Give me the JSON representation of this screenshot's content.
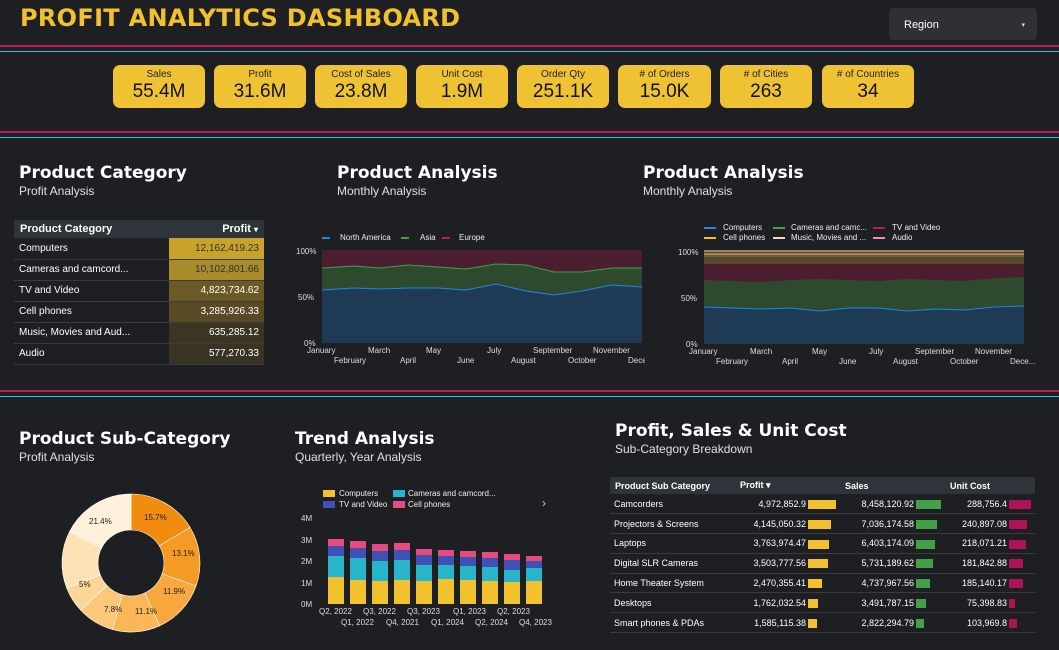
{
  "header": {
    "title": "PROFIT ANALYTICS DASHBOARD",
    "region_label": "Region",
    "region_caret": "▾"
  },
  "kpis": [
    {
      "label": "Sales",
      "value": "55.4M"
    },
    {
      "label": "Profit",
      "value": "31.6M"
    },
    {
      "label": "Cost of Sales",
      "value": "23.8M"
    },
    {
      "label": "Unit Cost",
      "value": "1.9M"
    },
    {
      "label": "Order Qty",
      "value": "251.1K"
    },
    {
      "label": "# of Orders",
      "value": "15.0K"
    },
    {
      "label": "# of Cities",
      "value": "263"
    },
    {
      "label": "# of Countries",
      "value": "34"
    }
  ],
  "colors": {
    "accent": "#f2c12e",
    "kpi_bg": "#eec232",
    "line_pink": "#c2185b",
    "line_teal": "#26c6da",
    "bg": "#1e1f23"
  },
  "product_category": {
    "title": "Product Category",
    "subtitle": "Profit Analysis",
    "col1": "Product Category",
    "col2": "Profit",
    "sort_icon": "▾",
    "rows": [
      {
        "name": "Computers",
        "profit": "12,162,419.23",
        "shade": "#c8a32a"
      },
      {
        "name": "Cameras and camcord...",
        "profit": "10,102,801.66",
        "shade": "#a88b2a"
      },
      {
        "name": "TV and Video",
        "profit": "4,823,734.62",
        "shade": "#6b5a26"
      },
      {
        "name": "Cell phones",
        "profit": "3,285,926.33",
        "shade": "#574a24"
      },
      {
        "name": "Music, Movies and Aud...",
        "profit": "635,285.12",
        "shade": "#3b3522"
      },
      {
        "name": "Audio",
        "profit": "577,270.33",
        "shade": "#383322"
      }
    ]
  },
  "product_analysis_1": {
    "title": "Product Analysis",
    "subtitle": "Monthly Analysis",
    "legend": [
      "North America",
      "Asia",
      "Europe"
    ],
    "y_ticks": [
      "100%",
      "50%",
      "0%"
    ],
    "months_top": [
      "January",
      "March",
      "May",
      "July",
      "September",
      "November"
    ],
    "months_bottom": [
      "February",
      "April",
      "June",
      "August",
      "October",
      "Dece..."
    ]
  },
  "product_analysis_2": {
    "title": "Product Analysis",
    "subtitle": "Monthly Analysis",
    "legend": [
      "Computers",
      "Cameras and camc...",
      "TV and Video",
      "Cell phones",
      "Music, Movies and ...",
      "Audio"
    ],
    "y_ticks": [
      "100%",
      "50%",
      "0%"
    ],
    "months_top": [
      "January",
      "March",
      "May",
      "July",
      "September",
      "November"
    ],
    "months_bottom": [
      "February",
      "April",
      "June",
      "August",
      "October",
      "Dece..."
    ]
  },
  "sub_category": {
    "title": "Product Sub-Category",
    "subtitle": "Profit Analysis",
    "slices": [
      "15.7%",
      "13.1%",
      "11.9%",
      "11.1%",
      "7.8%",
      "5%",
      "21.4%"
    ]
  },
  "trend": {
    "title": "Trend Analysis",
    "subtitle": "Quarterly, Year Analysis",
    "legend": [
      "Computers",
      "Cameras and camcord...",
      "TV and Video",
      "Cell phones"
    ],
    "y_ticks": [
      "4M",
      "3M",
      "2M",
      "1M",
      "0M"
    ],
    "x_top": [
      "Q2, 2022",
      "Q3, 2022",
      "Q3, 2023",
      "Q1, 2023",
      "Q2, 2023"
    ],
    "x_bottom": [
      "Q1, 2022",
      "Q4, 2021",
      "Q1, 2024",
      "Q2, 2024",
      "Q4, 2023"
    ],
    "nav_icon": "›"
  },
  "breakdown": {
    "title": "Profit, Sales & Unit Cost",
    "subtitle": "Sub-Category Breakdown",
    "cols": [
      "Product Sub Category",
      "Profit",
      "Sales",
      "Unit Cost"
    ],
    "sort_icon": "▾",
    "rows": [
      {
        "name": "Camcorders",
        "profit": "4,972,852.9",
        "sales": "8,458,120.92",
        "cost": "288,756.4"
      },
      {
        "name": "Projectors & Screens",
        "profit": "4,145,050.32",
        "sales": "7,036,174.58",
        "cost": "240,897.08"
      },
      {
        "name": "Laptops",
        "profit": "3,763,974.47",
        "sales": "6,403,174.09",
        "cost": "218,071.21"
      },
      {
        "name": "Digital SLR Cameras",
        "profit": "3,503,777.56",
        "sales": "5,731,189.62",
        "cost": "181,842.88"
      },
      {
        "name": "Home Theater System",
        "profit": "2,470,355.41",
        "sales": "4,737,967.56",
        "cost": "185,140.17"
      },
      {
        "name": "Desktops",
        "profit": "1,762,032.54",
        "sales": "3,491,787.15",
        "cost": "75,398.83"
      },
      {
        "name": "Smart phones & PDAs",
        "profit": "1,585,115.38",
        "sales": "2,822,294.79",
        "cost": "103,969.8"
      }
    ],
    "bar_fractions": {
      "profit": [
        1.0,
        0.83,
        0.76,
        0.7,
        0.5,
        0.35,
        0.32
      ],
      "sales": [
        1.0,
        0.83,
        0.76,
        0.68,
        0.56,
        0.41,
        0.33
      ],
      "cost": [
        1.0,
        0.83,
        0.76,
        0.63,
        0.64,
        0.26,
        0.36
      ]
    }
  }
}
